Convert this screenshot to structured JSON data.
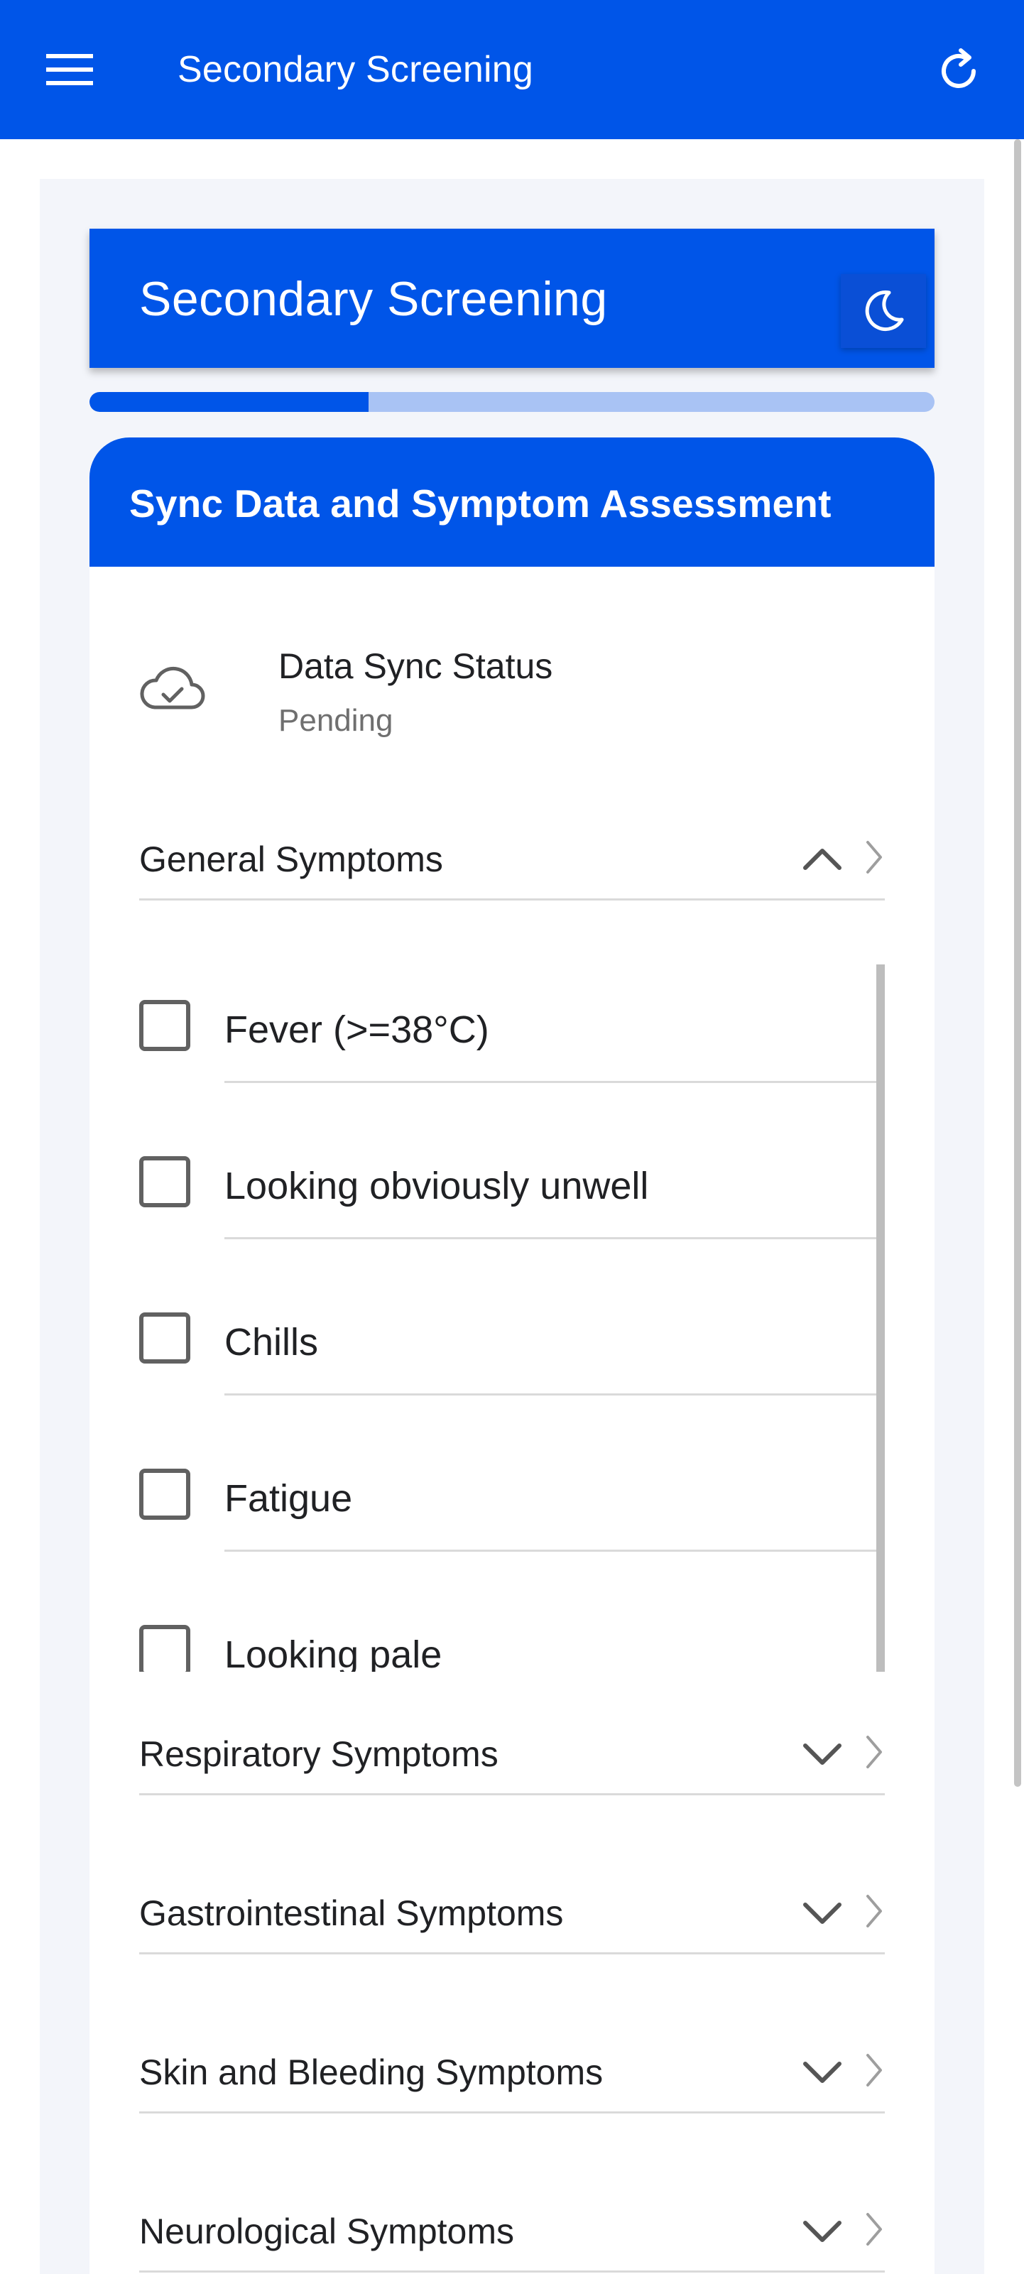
{
  "appbar": {
    "title": "Secondary Screening",
    "menu_icon": "menu-icon",
    "refresh_icon": "refresh-icon",
    "color": "#0055e8"
  },
  "header": {
    "title": "Secondary Screening",
    "theme_icon": "moon-icon"
  },
  "progress": {
    "percent": 33
  },
  "card": {
    "title": "Sync Data and Symptom Assessment",
    "sync": {
      "icon": "cloud-check-icon",
      "label": "Data Sync Status",
      "value": "Pending"
    },
    "sections": [
      {
        "label": "General Symptoms",
        "expanded": true,
        "items": [
          {
            "label": "Fever (>=38°C)",
            "checked": false
          },
          {
            "label": "Looking obviously unwell",
            "checked": false
          },
          {
            "label": "Chills",
            "checked": false
          },
          {
            "label": "Fatigue",
            "checked": false
          },
          {
            "label": "Looking pale",
            "checked": false
          }
        ]
      },
      {
        "label": "Respiratory Symptoms",
        "expanded": false
      },
      {
        "label": "Gastrointestinal Symptoms",
        "expanded": false
      },
      {
        "label": "Skin and Bleeding Symptoms",
        "expanded": false
      },
      {
        "label": "Neurological Symptoms",
        "expanded": false
      }
    ]
  }
}
